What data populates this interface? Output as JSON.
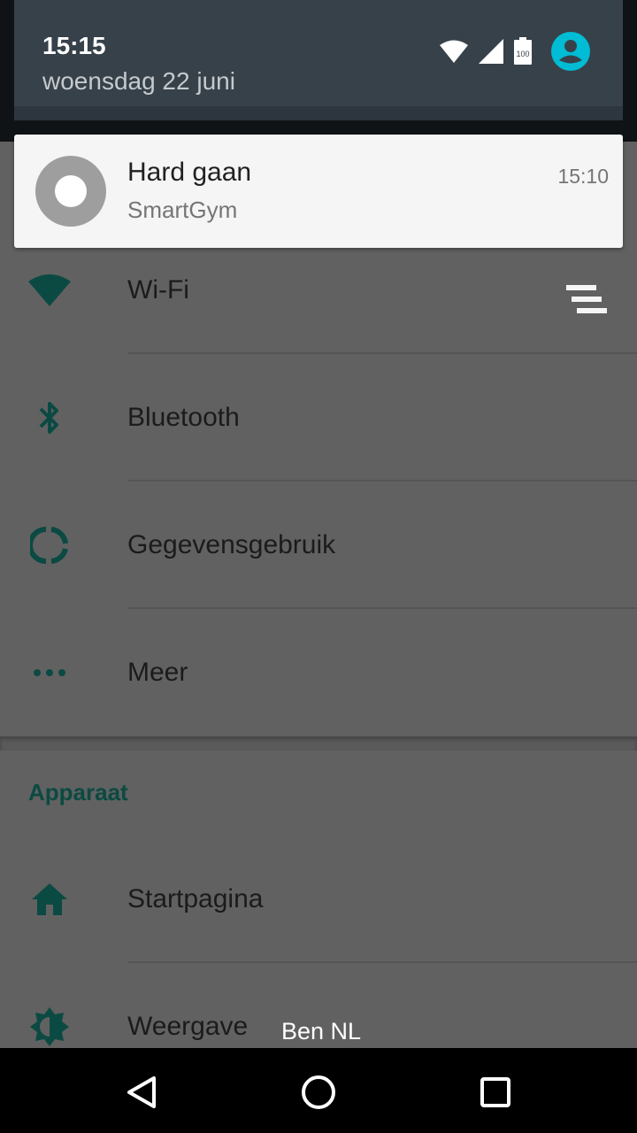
{
  "status_bar": {
    "time": "15:15",
    "date": "woensdag 22 juni",
    "icons": [
      "wifi-icon",
      "cell-signal-icon",
      "battery-icon",
      "user-avatar-icon"
    ],
    "battery_label": "100",
    "avatar_color": "#00BCD4"
  },
  "notification": {
    "title": "Hard gaan",
    "app": "SmartGym",
    "time": "15:10"
  },
  "settings": {
    "items": [
      {
        "label": "Wi-Fi",
        "icon": "wifi-icon"
      },
      {
        "label": "Bluetooth",
        "icon": "bluetooth-icon"
      },
      {
        "label": "Gegevensgebruik",
        "icon": "data-usage-icon"
      },
      {
        "label": "Meer",
        "icon": "more-icon"
      }
    ],
    "section_title": "Apparaat",
    "device_items": [
      {
        "label": "Startpagina",
        "icon": "home-icon"
      },
      {
        "label": "Weergave",
        "icon": "brightness-icon"
      }
    ],
    "accent_color": "#0B4A42"
  },
  "toast": "Ben NL",
  "nav": {
    "buttons": [
      "back-icon",
      "home-circle-icon",
      "recents-icon"
    ]
  }
}
